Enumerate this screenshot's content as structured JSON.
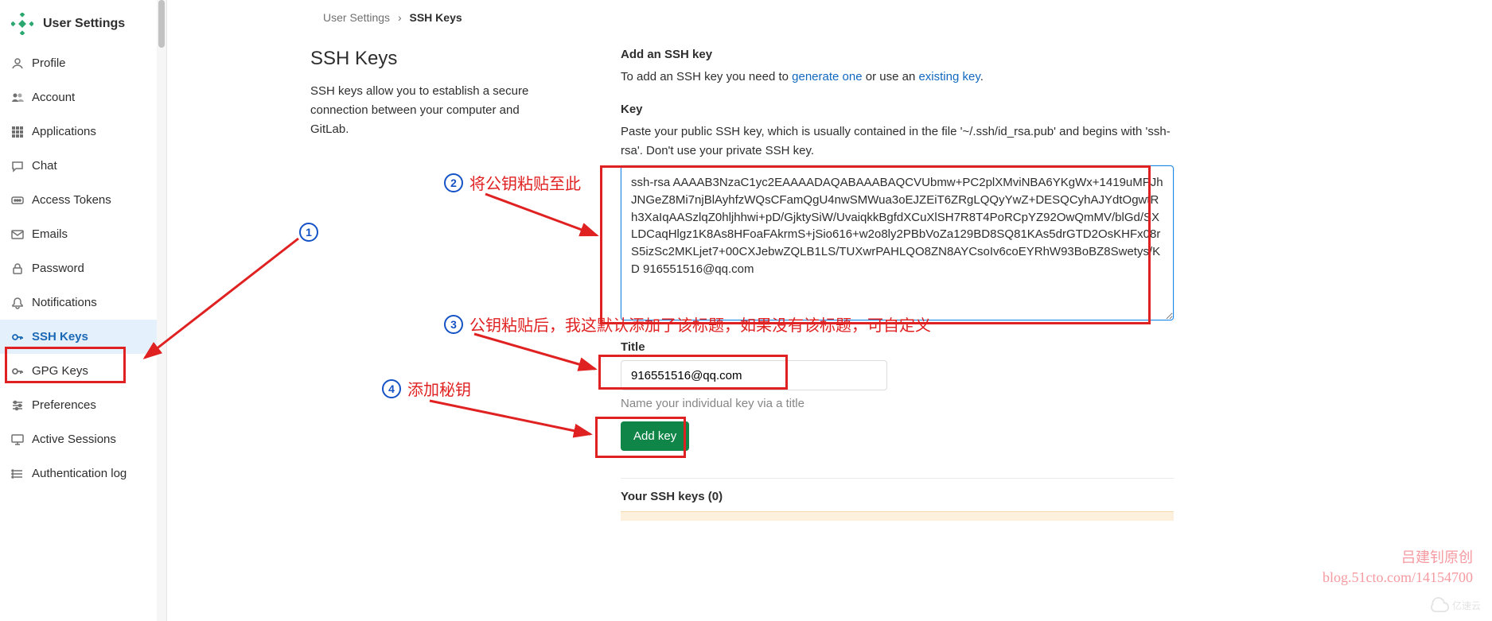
{
  "brand": {
    "title": "User Settings"
  },
  "sidebar": {
    "items": [
      {
        "label": "Profile",
        "icon": "profile-icon"
      },
      {
        "label": "Account",
        "icon": "account-icon"
      },
      {
        "label": "Applications",
        "icon": "applications-icon"
      },
      {
        "label": "Chat",
        "icon": "chat-icon"
      },
      {
        "label": "Access Tokens",
        "icon": "token-icon"
      },
      {
        "label": "Emails",
        "icon": "mail-icon"
      },
      {
        "label": "Password",
        "icon": "lock-icon"
      },
      {
        "label": "Notifications",
        "icon": "bell-icon"
      },
      {
        "label": "SSH Keys",
        "icon": "key-icon"
      },
      {
        "label": "GPG Keys",
        "icon": "key-icon"
      },
      {
        "label": "Preferences",
        "icon": "sliders-icon"
      },
      {
        "label": "Active Sessions",
        "icon": "monitor-icon"
      },
      {
        "label": "Authentication log",
        "icon": "list-icon"
      }
    ],
    "active_index": 8
  },
  "breadcrumb": {
    "root": "User Settings",
    "sep": "›",
    "current": "SSH Keys"
  },
  "main": {
    "heading": "SSH Keys",
    "desc": "SSH keys allow you to establish a secure connection between your computer and GitLab.",
    "add": {
      "heading": "Add an SSH key",
      "intro_pre": "To add an SSH key you need to ",
      "link1": "generate one",
      "intro_mid": " or use an ",
      "link2": "existing key",
      "intro_end": ".",
      "key_label": "Key",
      "key_help": "Paste your public SSH key, which is usually contained in the file '~/.ssh/id_rsa.pub' and begins with 'ssh-rsa'. Don't use your private SSH key.",
      "key_value": "ssh-rsa AAAAB3NzaC1yc2EAAAADAQABAAABAQCVUbmw+PC2plXMviNBA6YKgWx+1419uMPJhJNGeZ8Mi7njBlAyhfzWQsCFamQgU4nwSMWua3oEJZEiT6ZRgLQQyYwZ+DESQCyhAJYdtOgwtRh3XaIqAASzlqZ0hljhhwi+pD/GjktySiW/UvaiqkkBgfdXCuXlSH7R8T4PoRCpYZ92OwQmMV/blGd/SXLDCaqHlgz1K8As8HFoaFAkrmS+jSio616+w2o8ly2PBbVoZa129BD8SQ81KAs5drGTD2OsKHFx08rS5izSc2MKLjet7+00CXJebwZQLB1LS/TUXwrPAHLQO8ZN8AYCsoIv6coEYRhW93BoBZ8Swetys/KD 916551516@qq.com",
      "title_label": "Title",
      "title_value": "916551516@qq.com",
      "title_hint": "Name your individual key via a title",
      "submit_label": "Add key"
    },
    "list": {
      "heading": "Your SSH keys (0)"
    }
  },
  "annotations": {
    "c1": "1",
    "c2": "2",
    "c2_text": "将公钥粘贴至此",
    "c3": "3",
    "c3_text": "公钥粘贴后，我这默认添加了该标题，如果没有该标题，可自定义",
    "c4": "4",
    "c4_text": "添加秘钥"
  },
  "watermark": {
    "line1": "吕建钊原创",
    "line2": "blog.51cto.com/14154700",
    "logo": "亿速云"
  }
}
